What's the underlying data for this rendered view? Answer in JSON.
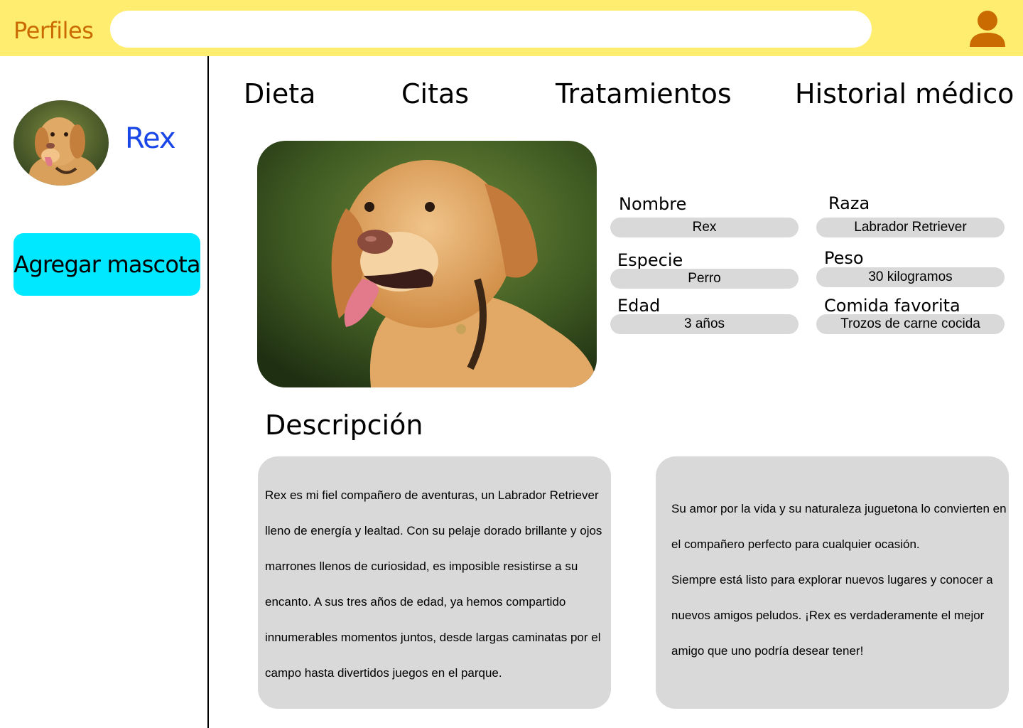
{
  "header": {
    "title": "Perfiles",
    "search_placeholder": "",
    "user_icon": "user-icon"
  },
  "sidebar": {
    "pet_name": "Rex",
    "add_pet_label": "Agregar mascota"
  },
  "tabs": [
    {
      "label": "Dieta"
    },
    {
      "label": "Citas"
    },
    {
      "label": "Tratamientos"
    },
    {
      "label": "Historial médico"
    }
  ],
  "pet": {
    "fields": [
      {
        "label": "Nombre",
        "value": "Rex"
      },
      {
        "label": "Raza",
        "value": "Labrador Retriever"
      },
      {
        "label": "Especie",
        "value": "Perro"
      },
      {
        "label": "Peso",
        "value": "30 kilogramos"
      },
      {
        "label": "Edad",
        "value": "3 años"
      },
      {
        "label": "Comida favorita",
        "value": "Trozos de carne cocida"
      }
    ]
  },
  "description": {
    "title": "Descripción",
    "left": [
      "Rex es mi fiel compañero de aventuras, un Labrador Retriever",
      "lleno de energía y lealtad. Con su pelaje dorado brillante y ojos",
      "marrones llenos de curiosidad, es imposible resistirse a su",
      "encanto. A sus tres años de edad, ya hemos compartido",
      "innumerables momentos juntos, desde largas caminatas por el",
      "campo hasta divertidos juegos en el parque."
    ],
    "right": [
      "Su amor por la vida y su naturaleza juguetona lo convierten en",
      "el compañero perfecto para cualquier ocasión.",
      "Siempre está listo para explorar nuevos lugares y conocer a",
      "nuevos amigos peludos. ¡Rex es verdaderamente el mejor",
      "amigo que uno podría desear tener!"
    ]
  },
  "colors": {
    "header_bg": "#ffed6f",
    "brand": "#c96b00",
    "pet_name": "#1946e6",
    "add_button": "#00e8ff",
    "field_bg": "#d9d9d9"
  }
}
